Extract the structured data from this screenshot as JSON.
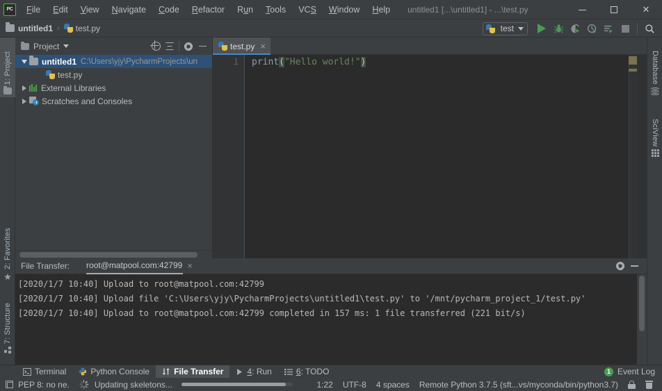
{
  "titlebar": {
    "logo": "PC",
    "window_title": "untitled1 [...\\untitled1] - ...\\test.py",
    "menus": [
      {
        "label": "File",
        "mnemonic": "F"
      },
      {
        "label": "Edit",
        "mnemonic": "E"
      },
      {
        "label": "View",
        "mnemonic": "V"
      },
      {
        "label": "Navigate",
        "mnemonic": "N"
      },
      {
        "label": "Code",
        "mnemonic": "C"
      },
      {
        "label": "Refactor",
        "mnemonic": "R"
      },
      {
        "label": "Run",
        "mnemonic": "u"
      },
      {
        "label": "Tools",
        "mnemonic": "T"
      },
      {
        "label": "VCS",
        "mnemonic": "S"
      },
      {
        "label": "Window",
        "mnemonic": "W"
      },
      {
        "label": "Help",
        "mnemonic": "H"
      }
    ],
    "minimize_label": "Minimize",
    "maximize_label": "Maximize",
    "close_label": "Close"
  },
  "navbar": {
    "crumbs": [
      {
        "label": "untitled1",
        "icon": "folder-icon"
      },
      {
        "label": "test.py",
        "icon": "python-file-icon"
      }
    ],
    "separator": "›"
  },
  "toolbar": {
    "run_config": "test",
    "buttons": [
      {
        "name": "run-button",
        "label": "Run"
      },
      {
        "name": "debug-button",
        "label": "Debug"
      },
      {
        "name": "run-with-coverage-button",
        "label": "Run with Coverage"
      },
      {
        "name": "profile-button",
        "label": "Profile"
      },
      {
        "name": "run-with-concurrency-diagram-button",
        "label": "Concurrency Diagram"
      },
      {
        "name": "stop-button",
        "label": "Stop"
      },
      {
        "name": "search-everywhere-button",
        "label": "Search Everywhere"
      }
    ]
  },
  "left_strip": [
    {
      "label": "1: Project",
      "icon": "project-icon",
      "active": true
    },
    {
      "label": "2: Favorites",
      "icon": "star-icon",
      "active": false
    },
    {
      "label": "7: Structure",
      "icon": "structure-icon",
      "active": false
    }
  ],
  "right_strip": [
    {
      "label": "Database",
      "icon": "database-icon"
    },
    {
      "label": "SciView",
      "icon": "grid-icon"
    }
  ],
  "project": {
    "title": "Project",
    "header_buttons": [
      {
        "name": "select-opened-file-button",
        "label": "Select Opened File"
      },
      {
        "name": "collapse-all-button",
        "label": "Collapse All"
      },
      {
        "name": "settings-gear-button",
        "label": "Settings"
      },
      {
        "name": "hide-panel-button",
        "label": "Hide"
      }
    ],
    "tree": [
      {
        "name": "untitled1",
        "path": "C:\\Users\\yjy\\PycharmProjects\\un",
        "arrow": "down",
        "icon": "folder-icon",
        "selected": true,
        "depth": 0
      },
      {
        "name": "test.py",
        "path": "",
        "arrow": "none",
        "icon": "python-file-icon",
        "selected": false,
        "depth": 1
      },
      {
        "name": "External Libraries",
        "path": "",
        "arrow": "right",
        "icon": "libraries-icon",
        "selected": false,
        "depth": 0
      },
      {
        "name": "Scratches and Consoles",
        "path": "",
        "arrow": "right",
        "icon": "scratches-icon",
        "selected": false,
        "depth": 0
      }
    ]
  },
  "editor": {
    "tab": {
      "label": "test.py",
      "close": "×",
      "icon": "python-file-icon"
    },
    "line_number": "1",
    "code": {
      "fn": "print",
      "open_paren": "(",
      "string": "\"Hello world!\"",
      "close_paren": ")"
    }
  },
  "file_transfer": {
    "title": "File Transfer:",
    "connection": "root@matpool.com:42799",
    "connection_close": "×",
    "header_buttons": [
      {
        "name": "settings-gear-button",
        "label": "Settings"
      },
      {
        "name": "hide-panel-button",
        "label": "Hide"
      }
    ],
    "log": [
      "[2020/1/7 10:40] Upload to root@matpool.com:42799",
      "[2020/1/7 10:40] Upload file 'C:\\Users\\yjy\\PycharmProjects\\untitled1\\test.py' to '/mnt/pycharm_project_1/test.py'",
      "[2020/1/7 10:40] Upload to root@matpool.com:42799 completed in 157 ms: 1 file transferred (221 bit/s)"
    ]
  },
  "bottom_bar": {
    "items": [
      {
        "label": "Terminal",
        "icon": "terminal-icon",
        "active": false,
        "mnemonic": ""
      },
      {
        "label": "Python Console",
        "icon": "python-console-icon",
        "active": false,
        "mnemonic": ""
      },
      {
        "label": "File Transfer",
        "icon": "transfer-arrows-icon",
        "active": true,
        "mnemonic": ""
      },
      {
        "label": "4: Run",
        "icon": "run-triangle-icon",
        "active": false,
        "mnemonic": "4"
      },
      {
        "label": "6: TODO",
        "icon": "todo-list-icon",
        "active": false,
        "mnemonic": "6"
      }
    ],
    "event_log": {
      "count": "1",
      "label": "Event Log"
    }
  },
  "status_bar": {
    "inspection": "PEP 8: no ne.",
    "background_task": "Updating skeletons...",
    "caret_position": "1:22",
    "encoding": "UTF-8",
    "indent": "4 spaces",
    "interpreter": "Remote Python 3.7.5 (sft...vs/myconda/bin/python3.7)",
    "lock_icon": "lock-icon",
    "trash_icon": "trash-icon"
  },
  "colors": {
    "panel_bg": "#3c3f41",
    "editor_bg": "#2b2b2b",
    "accent_blue": "#4a88c7",
    "selection_blue": "#2d5177",
    "green_run": "#499c54",
    "string_green": "#6a8759"
  }
}
